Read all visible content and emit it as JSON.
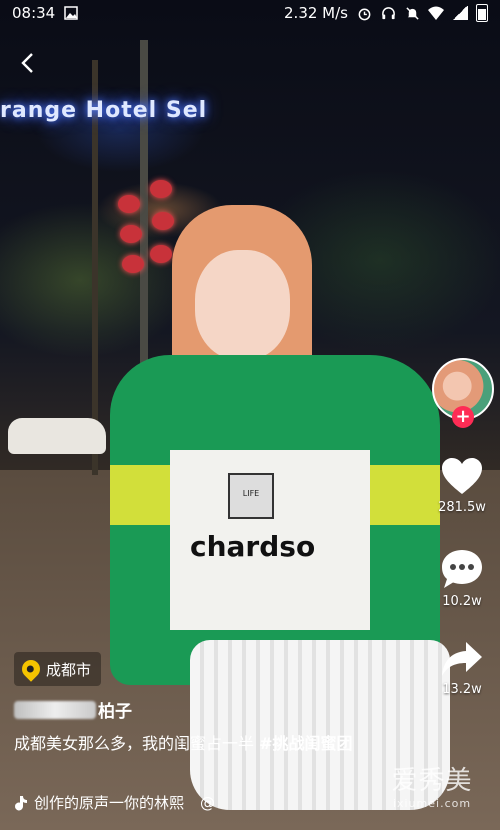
{
  "status_bar": {
    "time": "08:34",
    "network_speed": "2.32 M/s",
    "icons": [
      "image-icon",
      "alarm-icon",
      "headset-icon",
      "mute-icon",
      "wifi-icon",
      "signal-icon",
      "battery-icon"
    ]
  },
  "nav": {
    "back_icon": "chevron-left-icon"
  },
  "video_scene": {
    "sign_text": "range Hotel Sel"
  },
  "shirt_text": {
    "patch": "LIFE",
    "print": "chardso"
  },
  "right_rail": {
    "creator_avatar": "avatar",
    "follow_icon": "+",
    "like": {
      "icon": "heart-icon",
      "count": "281.5w"
    },
    "comment": {
      "icon": "comment-icon",
      "count": "10.2w"
    },
    "share": {
      "icon": "share-icon",
      "count": "13.2w"
    }
  },
  "video_info": {
    "location": "成都市",
    "username_suffix": "柏子",
    "caption": "成都美女那么多，我的闺蜜占一半",
    "hashtag": "#挑战闺蜜团",
    "music": "创作的原声一你的林熙",
    "mention": "@"
  },
  "watermark": {
    "title": "爱秀美",
    "subtitle": "ixiumei.com"
  },
  "colors": {
    "follow": "#fe2c55",
    "location_pin": "#f5c400"
  }
}
